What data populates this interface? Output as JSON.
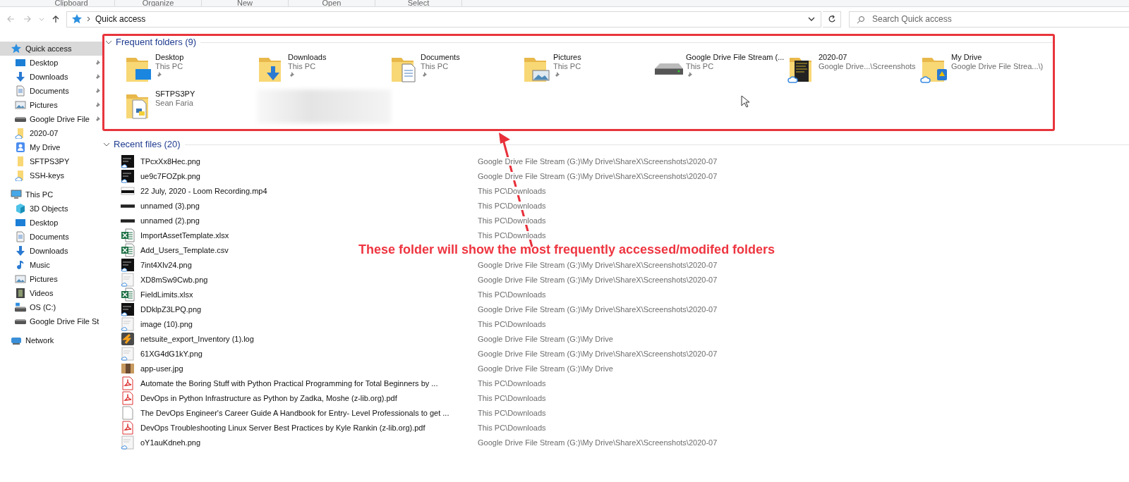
{
  "ribbon": {
    "groups": [
      "Clipboard",
      "Organize",
      "New",
      "Open",
      "Select"
    ]
  },
  "address_bar": {
    "path": [
      "Quick access"
    ]
  },
  "search": {
    "placeholder": "Search Quick access"
  },
  "sidebar": {
    "items": [
      {
        "label": "Quick access",
        "kind": "star",
        "selected": true,
        "children": [
          {
            "label": "Desktop",
            "kind": "desktop",
            "pinned": true
          },
          {
            "label": "Downloads",
            "kind": "downloads",
            "pinned": true
          },
          {
            "label": "Documents",
            "kind": "documents",
            "pinned": true
          },
          {
            "label": "Pictures",
            "kind": "pictures",
            "pinned": true
          },
          {
            "label": "Google Drive File",
            "kind": "drive",
            "pinned": true
          },
          {
            "label": "2020-07",
            "kind": "cloudfolder",
            "pinned": false
          },
          {
            "label": "My Drive",
            "kind": "gdrive",
            "pinned": false
          },
          {
            "label": "SFTPS3PY",
            "kind": "folder",
            "pinned": false
          },
          {
            "label": "SSH-keys",
            "kind": "cloudfolder",
            "pinned": false
          }
        ]
      },
      {
        "label": "This PC",
        "kind": "pc",
        "selected": false,
        "children": [
          {
            "label": "3D Objects",
            "kind": "objects",
            "pinned": false
          },
          {
            "label": "Desktop",
            "kind": "desktop",
            "pinned": false
          },
          {
            "label": "Documents",
            "kind": "documents",
            "pinned": false
          },
          {
            "label": "Downloads",
            "kind": "downloads",
            "pinned": false
          },
          {
            "label": "Music",
            "kind": "music",
            "pinned": false
          },
          {
            "label": "Pictures",
            "kind": "pictures",
            "pinned": false
          },
          {
            "label": "Videos",
            "kind": "videos",
            "pinned": false
          },
          {
            "label": "OS (C:)",
            "kind": "osdrive",
            "pinned": false
          },
          {
            "label": "Google Drive File St",
            "kind": "drive",
            "pinned": false
          }
        ]
      },
      {
        "label": "Network",
        "kind": "network",
        "selected": false
      }
    ]
  },
  "frequent_folders": {
    "title": "Frequent folders (9)",
    "expanded": true,
    "items": [
      {
        "name": "Desktop",
        "location": "This PC",
        "pinned": true,
        "kind": "desktop"
      },
      {
        "name": "Downloads",
        "location": "This PC",
        "pinned": true,
        "kind": "downloads"
      },
      {
        "name": "Documents",
        "location": "This PC",
        "pinned": true,
        "kind": "documents"
      },
      {
        "name": "Pictures",
        "location": "This PC",
        "pinned": true,
        "kind": "pictures"
      },
      {
        "name": "Google Drive File Stream (...",
        "location": "This PC",
        "pinned": true,
        "kind": "drive"
      },
      {
        "name": "2020-07",
        "location": "Google Drive...\\Screenshots",
        "pinned": false,
        "kind": "screenshots"
      },
      {
        "name": "My Drive",
        "location": "Google Drive File Strea...\\)",
        "pinned": false,
        "kind": "gdrive"
      },
      {
        "name": "SFTPS3PY",
        "location": "Sean Faria",
        "pinned": false,
        "kind": "python"
      }
    ]
  },
  "recent_files": {
    "title": "Recent files (20)",
    "expanded": true,
    "items": [
      {
        "name": "TPcxXx8Hec.png",
        "path": "Google Drive File Stream (G:)\\My Drive\\ShareX\\Screenshots\\2020-07",
        "kind": "image"
      },
      {
        "name": "ue9c7FOZpk.png",
        "path": "Google Drive File Stream (G:)\\My Drive\\ShareX\\Screenshots\\2020-07",
        "kind": "image"
      },
      {
        "name": "22 July, 2020 - Loom Recording.mp4",
        "path": "This PC\\Downloads",
        "kind": "video"
      },
      {
        "name": "unnamed (3).png",
        "path": "This PC\\Downloads",
        "kind": "strip"
      },
      {
        "name": "unnamed (2).png",
        "path": "This PC\\Downloads",
        "kind": "strip"
      },
      {
        "name": "ImportAssetTemplate.xlsx",
        "path": "This PC\\Downloads",
        "kind": "spreadsheet"
      },
      {
        "name": "Add_Users_Template.csv",
        "kind": "spreadsheet"
      },
      {
        "name": "7int4Xlv24.png",
        "path": "Google Drive File Stream (G:)\\My Drive\\ShareX\\Screenshots\\2020-07",
        "kind": "image"
      },
      {
        "name": "XD8mSw9Cwb.png",
        "path": "Google Drive File Stream (G:)\\My Drive\\ShareX\\Screenshots\\2020-07",
        "kind": "screenshot"
      },
      {
        "name": "FieldLimits.xlsx",
        "path": "This PC\\Downloads",
        "kind": "spreadsheet"
      },
      {
        "name": "DDklpZ3LPQ.png",
        "path": "Google Drive File Stream (G:)\\My Drive\\ShareX\\Screenshots\\2020-07",
        "kind": "image"
      },
      {
        "name": "image (10).png",
        "path": "This PC\\Downloads",
        "kind": "screenshot"
      },
      {
        "name": "netsuite_export_Inventory (1).log",
        "path": "Google Drive File Stream (G:)\\My Drive",
        "kind": "log"
      },
      {
        "name": "61XG4dG1kY.png",
        "path": "Google Drive File Stream (G:)\\My Drive\\ShareX\\Screenshots\\2020-07",
        "kind": "screenshot"
      },
      {
        "name": "app-user.jpg",
        "path": "Google Drive File Stream (G:)\\My Drive",
        "kind": "photo"
      },
      {
        "name": "Automate the Boring Stuff with Python Practical Programming for Total Beginners by ...",
        "path": "This PC\\Downloads",
        "kind": "pdf"
      },
      {
        "name": "DevOps in Python  Infrastructure as Python by Zadka, Moshe (z-lib.org).pdf",
        "path": "This PC\\Downloads",
        "kind": "pdf"
      },
      {
        "name": "The DevOps Engineer's Career Guide A Handbook for Entry- Level Professionals to get ...",
        "path": "This PC\\Downloads",
        "kind": "document"
      },
      {
        "name": "DevOps Troubleshooting Linux Server Best Practices by Kyle Rankin (z-lib.org).pdf",
        "path": "This PC\\Downloads",
        "kind": "pdf"
      },
      {
        "name": "oY1auKdneh.png",
        "path": "Google Drive File Stream (G:)\\My Drive\\ShareX\\Screenshots\\2020-07",
        "kind": "screenshot"
      }
    ]
  },
  "annotation": {
    "text": "These folder will show the most frequently accessed/modifed folders"
  }
}
